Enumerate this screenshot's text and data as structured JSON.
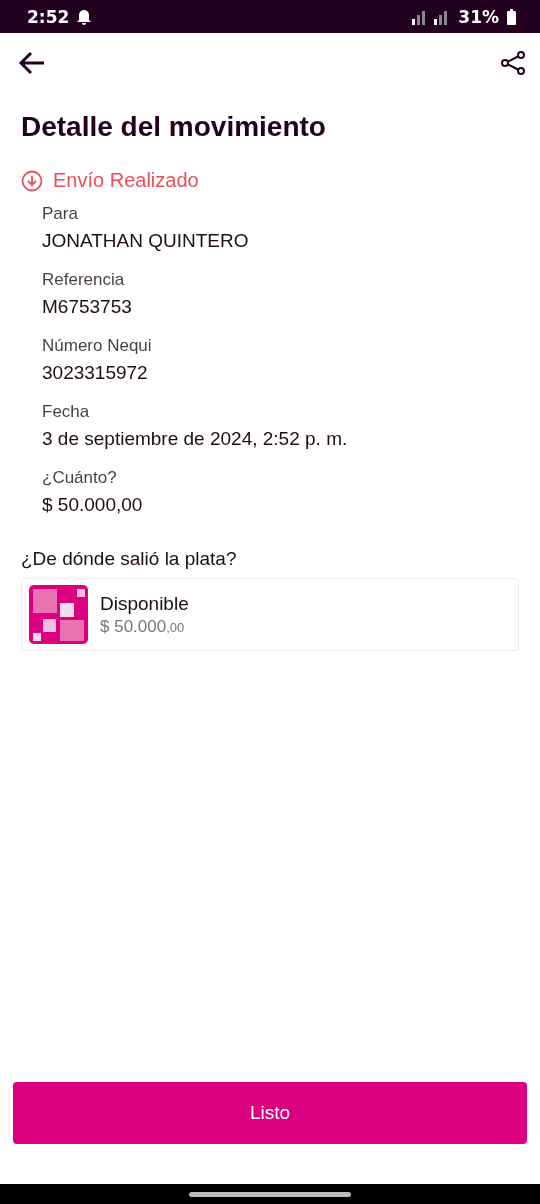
{
  "status_bar": {
    "time": "2:52",
    "battery": "31%"
  },
  "title": "Detalle del movimiento",
  "status": {
    "label": "Envío Realizado"
  },
  "fields": [
    {
      "label": "Para",
      "value": "JONATHAN QUINTERO"
    },
    {
      "label": "Referencia",
      "value": "M6753753"
    },
    {
      "label": "Número Nequi",
      "value": "3023315972"
    },
    {
      "label": "Fecha",
      "value": "3 de septiembre de 2024, 2:52 p. m."
    },
    {
      "label": "¿Cuánto?",
      "value": "$ 50.000,00"
    }
  ],
  "source": {
    "question": "¿De dónde salió la plata?",
    "name": "Disponible",
    "amount": "$ 50.000",
    "cents": ",00"
  },
  "button": "Listo"
}
